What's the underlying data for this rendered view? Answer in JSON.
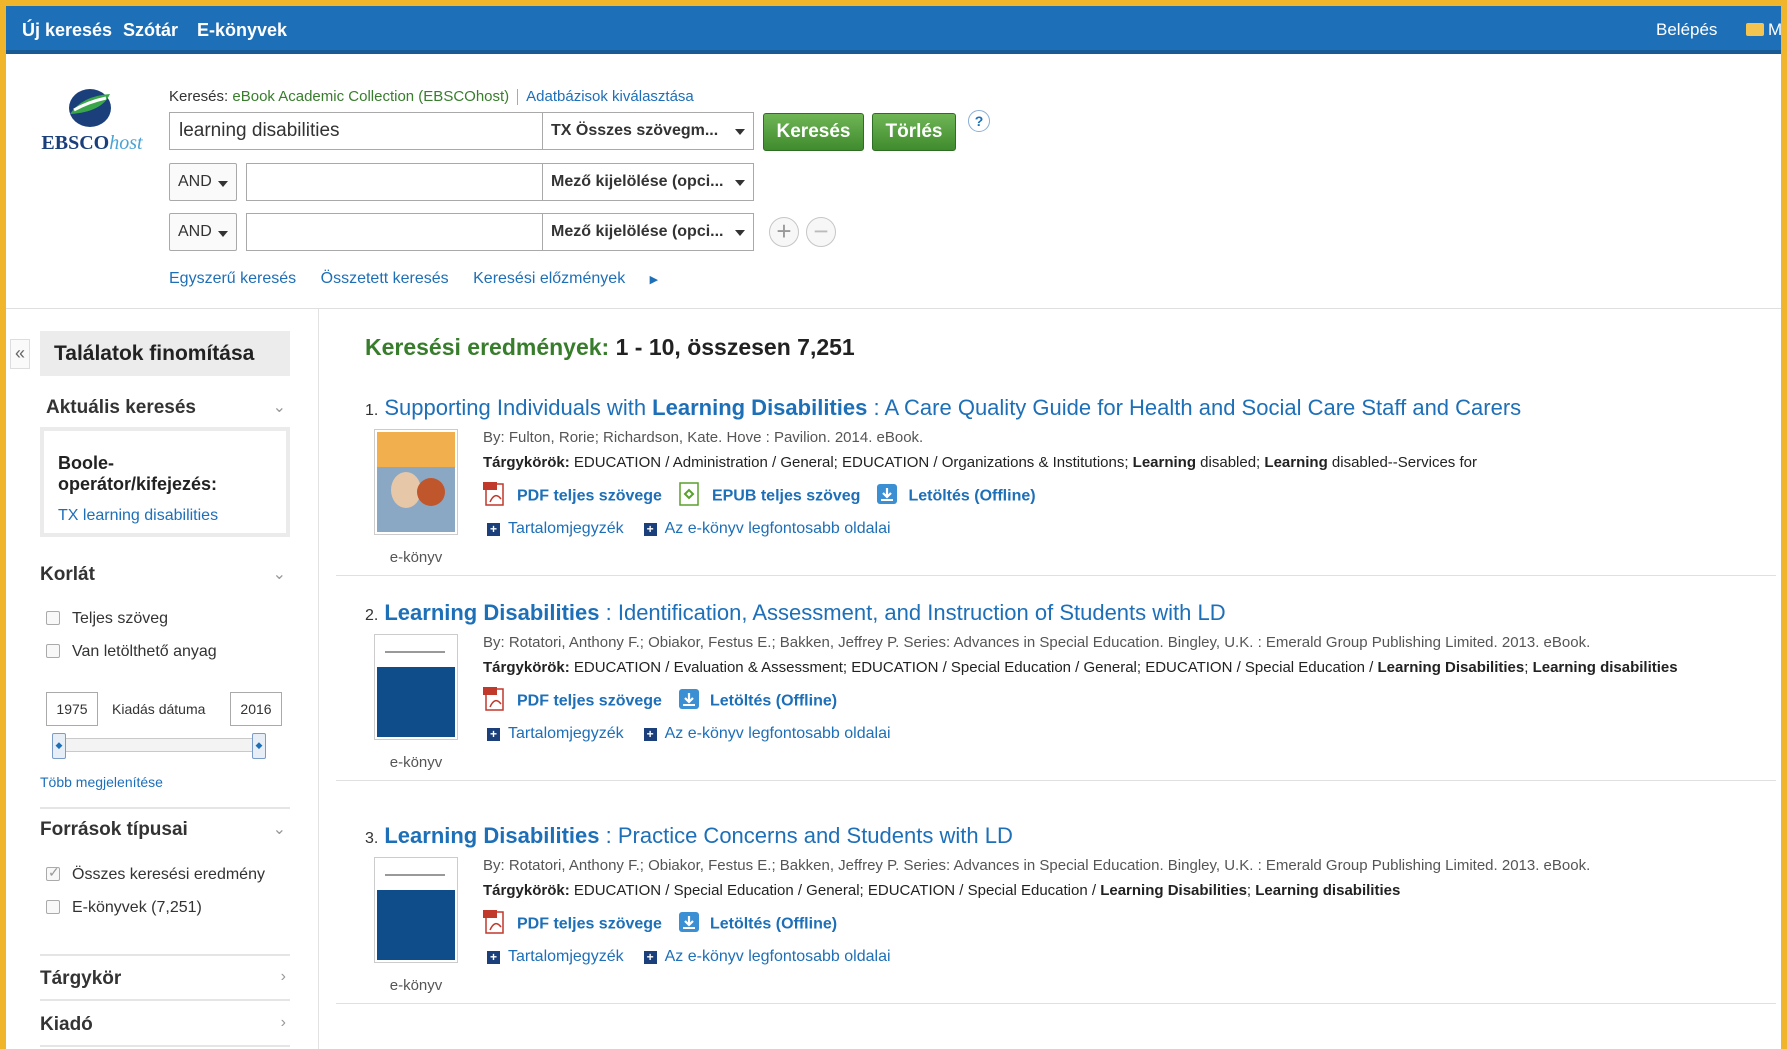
{
  "topbar": {
    "nav": [
      "Új keresés",
      "Szótár",
      "E-könyvek"
    ],
    "login": "Belépés",
    "folder_label": "M"
  },
  "search": {
    "logo_text_main": "EBSCO",
    "logo_text_host": "host",
    "searching_label": "Keresés:",
    "database": "eBook Academic Collection (EBSCOhost)",
    "choose_db": "Adatbázisok kiválasztása",
    "query": "learning disabilities",
    "field1": "TX Összes szövegm...",
    "search_btn": "Keresés",
    "clear_btn": "Törlés",
    "help": "?",
    "row2": {
      "bool": "AND",
      "value": "",
      "field": "Mező kijelölése (opci..."
    },
    "row3": {
      "bool": "AND",
      "value": "",
      "field": "Mező kijelölése (opci..."
    },
    "links": [
      "Egyszerű keresés",
      "Összetett keresés",
      "Keresési előzmények"
    ]
  },
  "sidebar": {
    "collapse": "«",
    "title": "Találatok finomítása",
    "current": "Aktuális keresés",
    "bool_label": "Boole-operátor/kifejezés:",
    "bool_value": "TX learning disabilities",
    "limit": "Korlát",
    "limits": [
      "Teljes szöveg",
      "Van letölthető anyag"
    ],
    "year_from": "1975",
    "year_to": "2016",
    "date_label": "Kiadás dátuma",
    "more": "Több megjelenítése",
    "source_types": "Források típusai",
    "sources": [
      {
        "label": "Összes keresési eredmény",
        "checked": true
      },
      {
        "label": "E-könyvek (7,251)",
        "checked": false
      }
    ],
    "subject": "Tárgykör",
    "publisher": "Kiadó"
  },
  "results": {
    "heading_label": "Keresési eredmények:",
    "heading_value": "1 - 10, összesen 7,251",
    "items": [
      {
        "num": "1.",
        "title_pre": "Supporting Individuals with ",
        "title_bold": "Learning Disabilities",
        "title_post": " : A Care Quality Guide for Health and Social Care Staff and Carers",
        "by": "By: Fulton, Rorie; Richardson, Kate. Hove : Pavilion. 2014. eBook.",
        "subjects_label": "Tárgykörök:",
        "subjects": "EDUCATION / Administration / General; EDUCATION / Organizations & Institutions; <b>Learning</b> disabled; <b>Learning</b> disabled--Services for",
        "pdf": "PDF teljes szövege",
        "epub": "EPUB teljes szöveg",
        "download": "Letöltés (Offline)",
        "toc": "Tartalomjegyzék",
        "pages": "Az e-könyv legfontosabb oldalai",
        "type": "e-könyv"
      },
      {
        "num": "2.",
        "title_pre": "",
        "title_bold": "Learning Disabilities",
        "title_post": " : Identification, Assessment, and Instruction of Students with LD",
        "by": "By: Rotatori, Anthony F.; Obiakor, Festus E.; Bakken, Jeffrey P. Series: Advances in Special Education. Bingley, U.K. : Emerald Group Publishing Limited. 2013. eBook.",
        "subjects_label": "Tárgykörök:",
        "subjects": "EDUCATION / Evaluation & Assessment; EDUCATION / Special Education / General; EDUCATION / Special Education / <b>Learning Disabilities</b>; <b>Learning disabilities</b>",
        "pdf": "PDF teljes szövege",
        "epub": "",
        "download": "Letöltés (Offline)",
        "toc": "Tartalomjegyzék",
        "pages": "Az e-könyv legfontosabb oldalai",
        "type": "e-könyv"
      },
      {
        "num": "3.",
        "title_pre": "",
        "title_bold": "Learning Disabilities",
        "title_post": " : Practice Concerns and Students with LD",
        "by": "By: Rotatori, Anthony F.; Obiakor, Festus E.; Bakken, Jeffrey P. Series: Advances in Special Education. Bingley, U.K. : Emerald Group Publishing Limited. 2013. eBook.",
        "subjects_label": "Tárgykörök:",
        "subjects": "EDUCATION / Special Education / General; EDUCATION / Special Education / <b>Learning Disabilities</b>; <b>Learning disabilities</b>",
        "pdf": "PDF teljes szövege",
        "epub": "",
        "download": "Letöltés (Offline)",
        "toc": "Tartalomjegyzék",
        "pages": "Az e-könyv legfontosabb oldalai",
        "type": "e-könyv"
      }
    ]
  },
  "colors": {
    "accent": "#1d6fb8",
    "green": "#377d2c",
    "frame": "#f0b52a"
  }
}
